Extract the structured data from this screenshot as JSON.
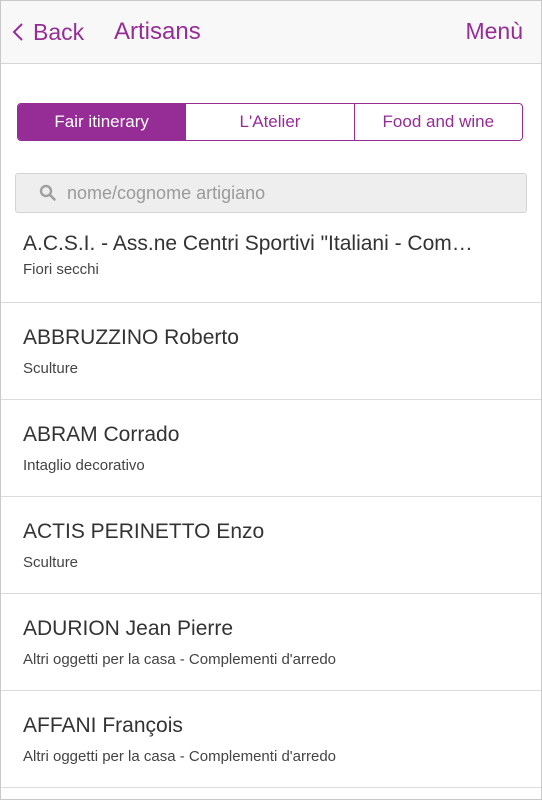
{
  "header": {
    "back_label": "Back",
    "title": "Artisans",
    "menu_label": "Menù"
  },
  "tabs": [
    {
      "label": "Fair itinerary",
      "active": true
    },
    {
      "label": "L'Atelier",
      "active": false
    },
    {
      "label": "Food and wine",
      "active": false
    }
  ],
  "search": {
    "placeholder": "nome/cognome artigiano",
    "value": ""
  },
  "artisans": [
    {
      "name": "A.C.S.I. - Ass.ne Centri Sportivi \"Italiani - Com…",
      "category": "Fiori secchi"
    },
    {
      "name": "ABBRUZZINO Roberto",
      "category": "Sculture"
    },
    {
      "name": "ABRAM Corrado",
      "category": "Intaglio decorativo"
    },
    {
      "name": "ACTIS PERINETTO Enzo",
      "category": "Sculture"
    },
    {
      "name": "ADURION Jean Pierre",
      "category": "Altri oggetti per la casa - Complementi d'arredo"
    },
    {
      "name": "AFFANI François",
      "category": "Altri oggetti per la casa - Complementi d'arredo"
    }
  ],
  "colors": {
    "accent": "#962d97",
    "header_bg": "#f8f8f8",
    "search_bg": "#eeeeee"
  }
}
